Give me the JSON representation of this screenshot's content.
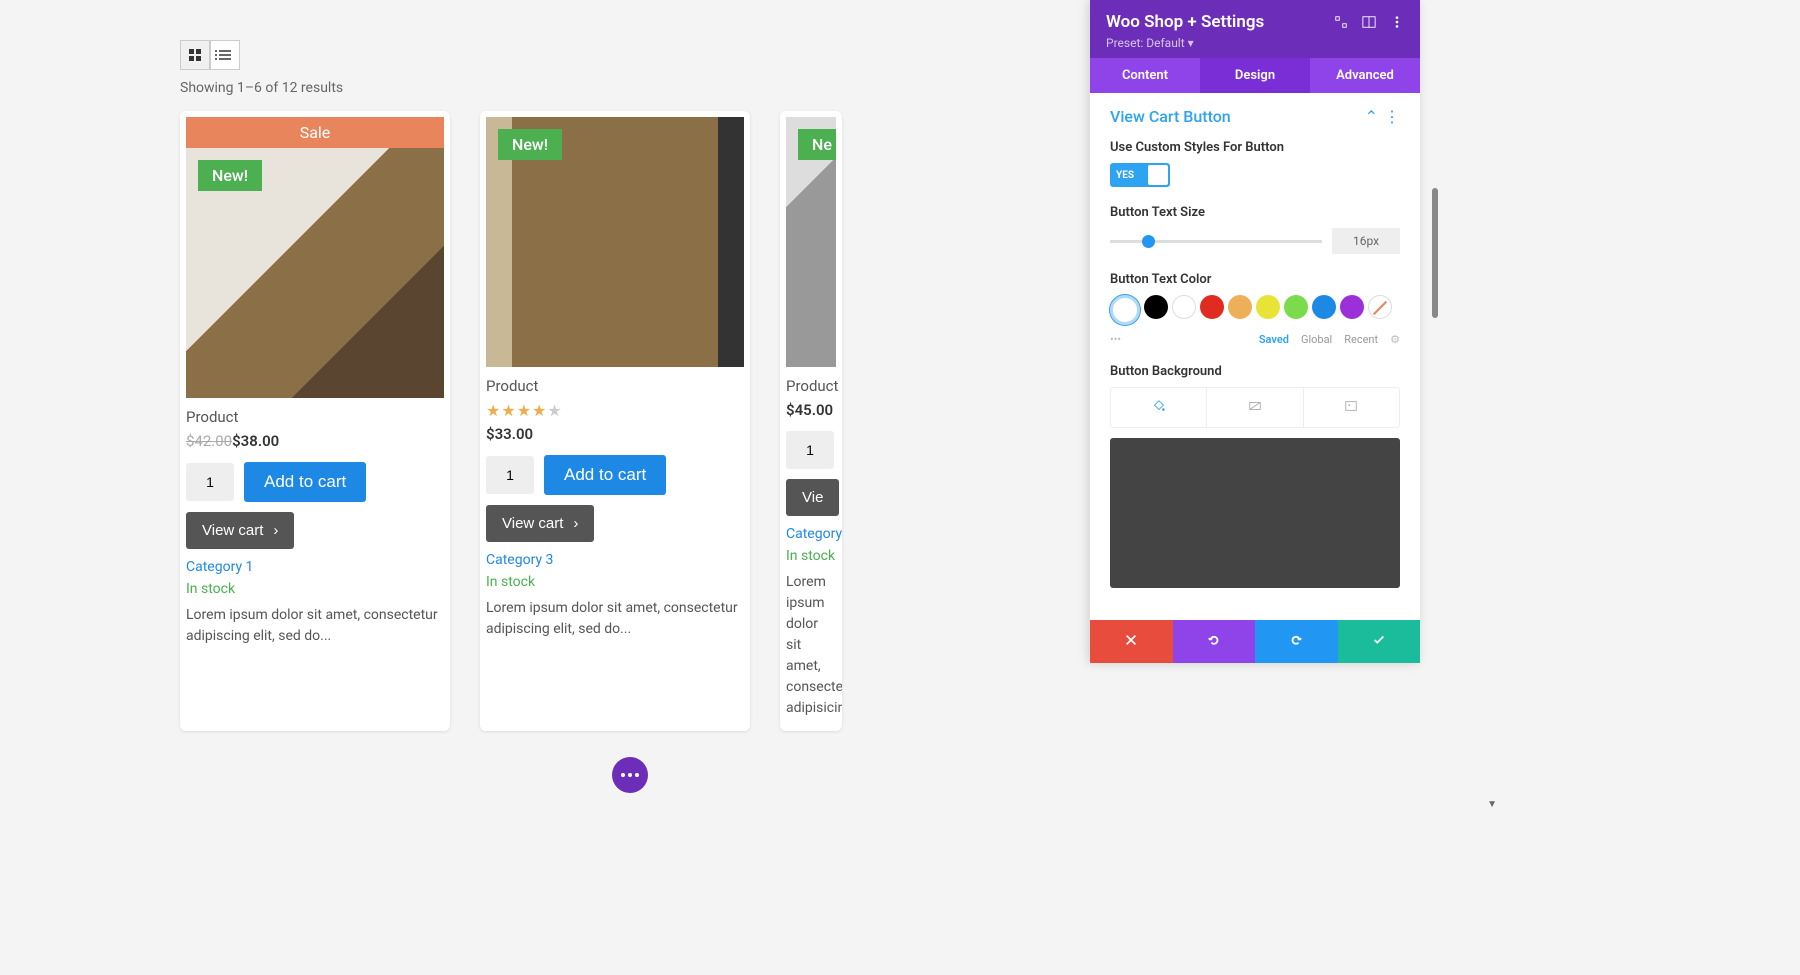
{
  "shop": {
    "results_text": "Showing 1–6 of 12 results",
    "new_badge": "New!",
    "sale_banner": "Sale",
    "add_to_cart": "Add to cart",
    "view_cart": "View cart",
    "products": [
      {
        "title": "Product",
        "old_price": "$42.00",
        "new_price": "$38.00",
        "qty": "1",
        "category": "Category 1",
        "stock": "In stock",
        "description": "Lorem ipsum dolor sit amet, consectetur adipiscing elit, sed do..."
      },
      {
        "title": "Product",
        "price": "$33.00",
        "qty": "1",
        "category": "Category 3",
        "stock": "In stock",
        "description": "Lorem ipsum dolor sit amet, consectetur adipiscing elit, sed do..."
      },
      {
        "title": "Product",
        "price": "$45.00",
        "qty": "1",
        "category": "Category",
        "stock": "In stock",
        "description": "Lorem ipsum dolor sit amet, consectetur adipisicing..."
      }
    ]
  },
  "panel": {
    "title": "Woo Shop + Settings",
    "preset": "Preset: Default",
    "tabs": {
      "content": "Content",
      "design": "Design",
      "advanced": "Advanced"
    },
    "section": "View Cart Button",
    "custom_styles_label": "Use Custom Styles For Button",
    "toggle_yes": "YES",
    "text_size_label": "Button Text Size",
    "text_size_value": "16px",
    "text_color_label": "Button Text Color",
    "color_palette": [
      "#000000",
      "#ffffff",
      "#e02b20",
      "#edb059",
      "#e8e337",
      "#7cdb4c",
      "#1e88e5",
      "#9b30d9"
    ],
    "color_tabs": {
      "saved": "Saved",
      "global": "Global",
      "recent": "Recent"
    },
    "background_label": "Button Background"
  }
}
